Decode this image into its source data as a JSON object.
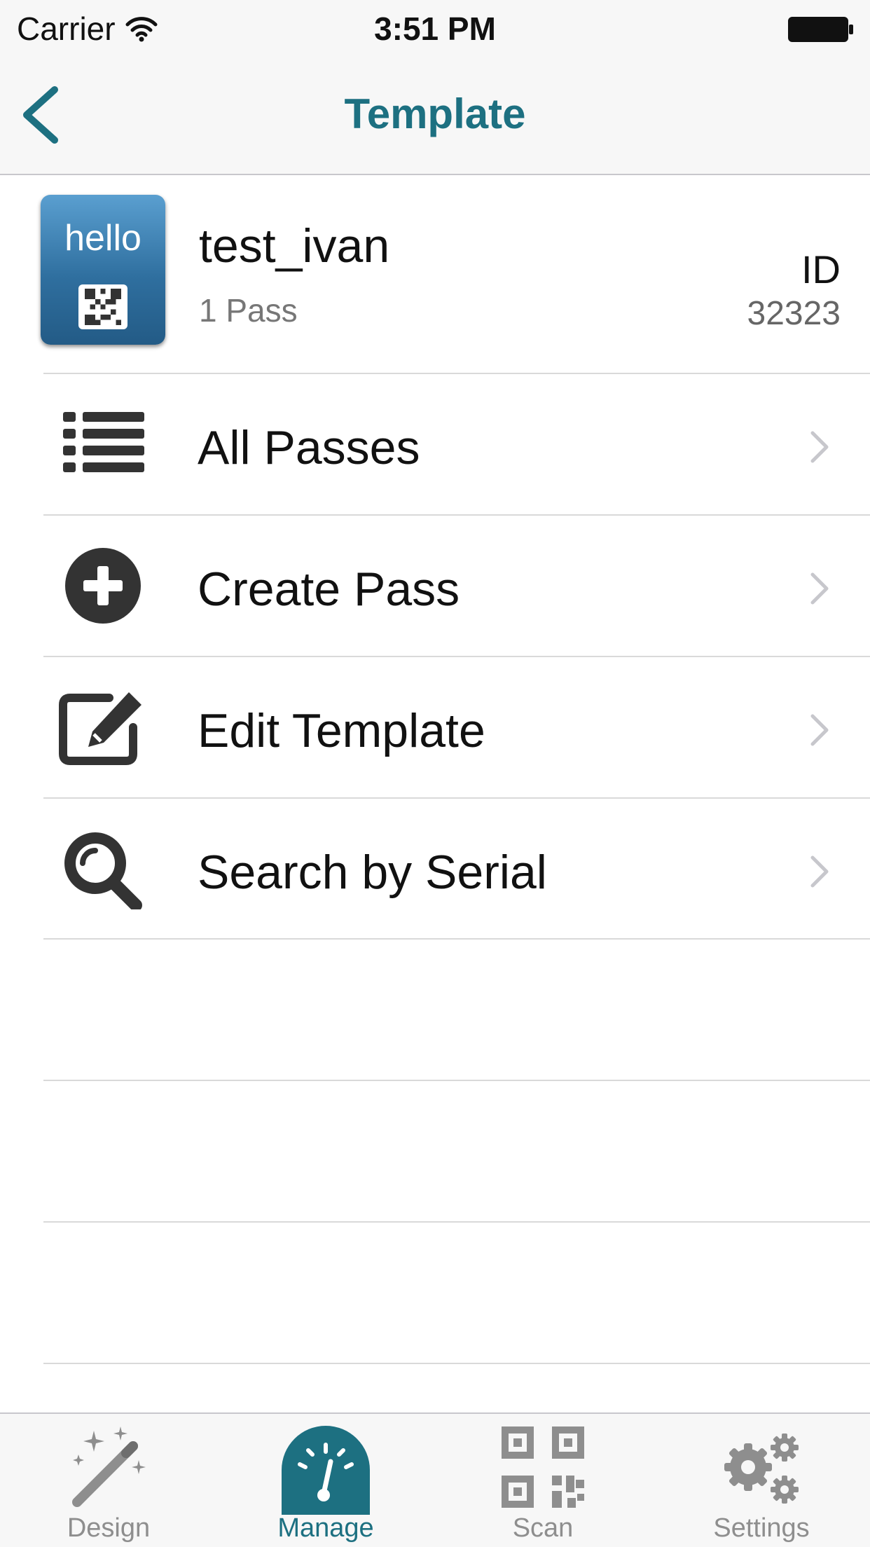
{
  "status_bar": {
    "carrier": "Carrier",
    "time": "3:51 PM"
  },
  "nav": {
    "title": "Template",
    "back_icon": "chevron-left-icon",
    "accent_color": "#1d7081"
  },
  "template": {
    "thumbnail_text": "hello",
    "name": "test_ivan",
    "pass_count": "1 Pass",
    "id_label": "ID",
    "id_value": "32323"
  },
  "menu": [
    {
      "label": "All Passes",
      "icon": "list-icon"
    },
    {
      "label": "Create Pass",
      "icon": "plus-circle-icon"
    },
    {
      "label": "Edit Template",
      "icon": "edit-icon"
    },
    {
      "label": "Search by Serial",
      "icon": "search-icon"
    }
  ],
  "tabs": [
    {
      "label": "Design",
      "icon": "magic-wand-icon",
      "active": false
    },
    {
      "label": "Manage",
      "icon": "dashboard-icon",
      "active": true
    },
    {
      "label": "Scan",
      "icon": "qr-code-icon",
      "active": false
    },
    {
      "label": "Settings",
      "icon": "gears-icon",
      "active": false
    }
  ]
}
